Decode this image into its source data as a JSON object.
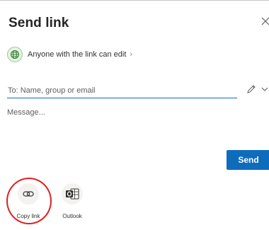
{
  "dialog": {
    "title": "Send link",
    "close_icon": "close-icon"
  },
  "permission": {
    "icon": "globe-icon",
    "label": "Anyone with the link can edit",
    "chevron": "›"
  },
  "recipient": {
    "placeholder": "To: Name, group or email",
    "value": ""
  },
  "message": {
    "placeholder": "Message...",
    "value": ""
  },
  "actions": {
    "send_label": "Send",
    "accent_color": "#0f6cbd"
  },
  "share_options": [
    {
      "icon": "copy-link-icon",
      "label": "Copy link",
      "highlighted": true
    },
    {
      "icon": "outlook-icon",
      "label": "Outlook",
      "highlighted": false
    }
  ],
  "annotation_color": "#e02020"
}
